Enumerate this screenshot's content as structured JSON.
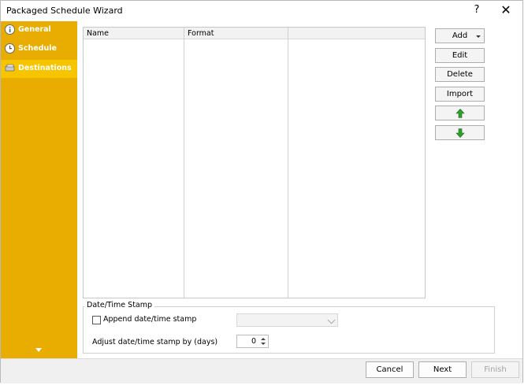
{
  "window": {
    "title": "Packaged Schedule Wizard",
    "help": "?",
    "close": "✕"
  },
  "sidebar": {
    "items": [
      {
        "label": "General",
        "icon": "info-icon"
      },
      {
        "label": "Schedule",
        "icon": "clock-icon"
      },
      {
        "label": "Destinations",
        "icon": "destinations-icon",
        "active": true
      }
    ],
    "scroll_down": "▼"
  },
  "grid": {
    "columns": [
      "Name",
      "Format",
      ""
    ]
  },
  "actions": {
    "add": "Add",
    "edit": "Edit",
    "delete": "Delete",
    "import": "Import",
    "move_up_icon": "green-up-arrow-icon",
    "move_down_icon": "green-down-arrow-icon"
  },
  "timestamp": {
    "group_title": "Date/Time Stamp",
    "append_label": "Append date/time stamp",
    "append_checked": false,
    "format_value": "",
    "adjust_label": "Adjust date/time stamp by (days)",
    "adjust_value": "0"
  },
  "footer": {
    "cancel": "Cancel",
    "next": "Next",
    "finish": "Finish"
  },
  "colors": {
    "sidebar": "#e8ad00",
    "sidebar_active": "#f7c500",
    "arrow_green": "#2e9e2e"
  }
}
